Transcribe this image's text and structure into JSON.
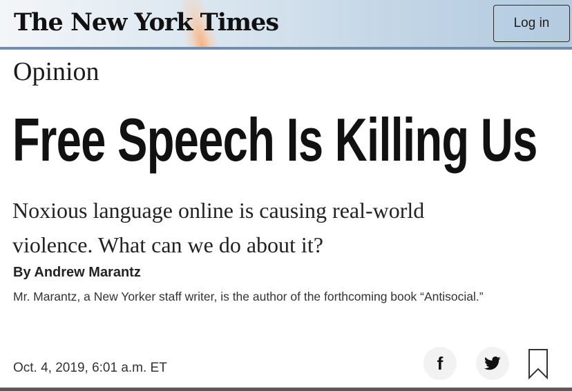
{
  "header": {
    "logo_text": "The New York Times",
    "login_label": "Log in",
    "accent_color": "#6d8db3"
  },
  "article": {
    "section": "Opinion",
    "headline": "Free Speech Is Killing Us",
    "summary": "Noxious language online is causing real-world violence. What can we do about it?",
    "byline": "By Andrew Marantz",
    "author_bio": "Mr. Marantz, a New Yorker staff writer, is the author of the forthcoming book “Antisocial.”",
    "timestamp": "Oct. 4, 2019, 6:01 a.m. ET"
  },
  "actions": {
    "facebook_icon": "f",
    "twitter_icon": "twitter-bird",
    "bookmark_icon": "bookmark-outline"
  }
}
